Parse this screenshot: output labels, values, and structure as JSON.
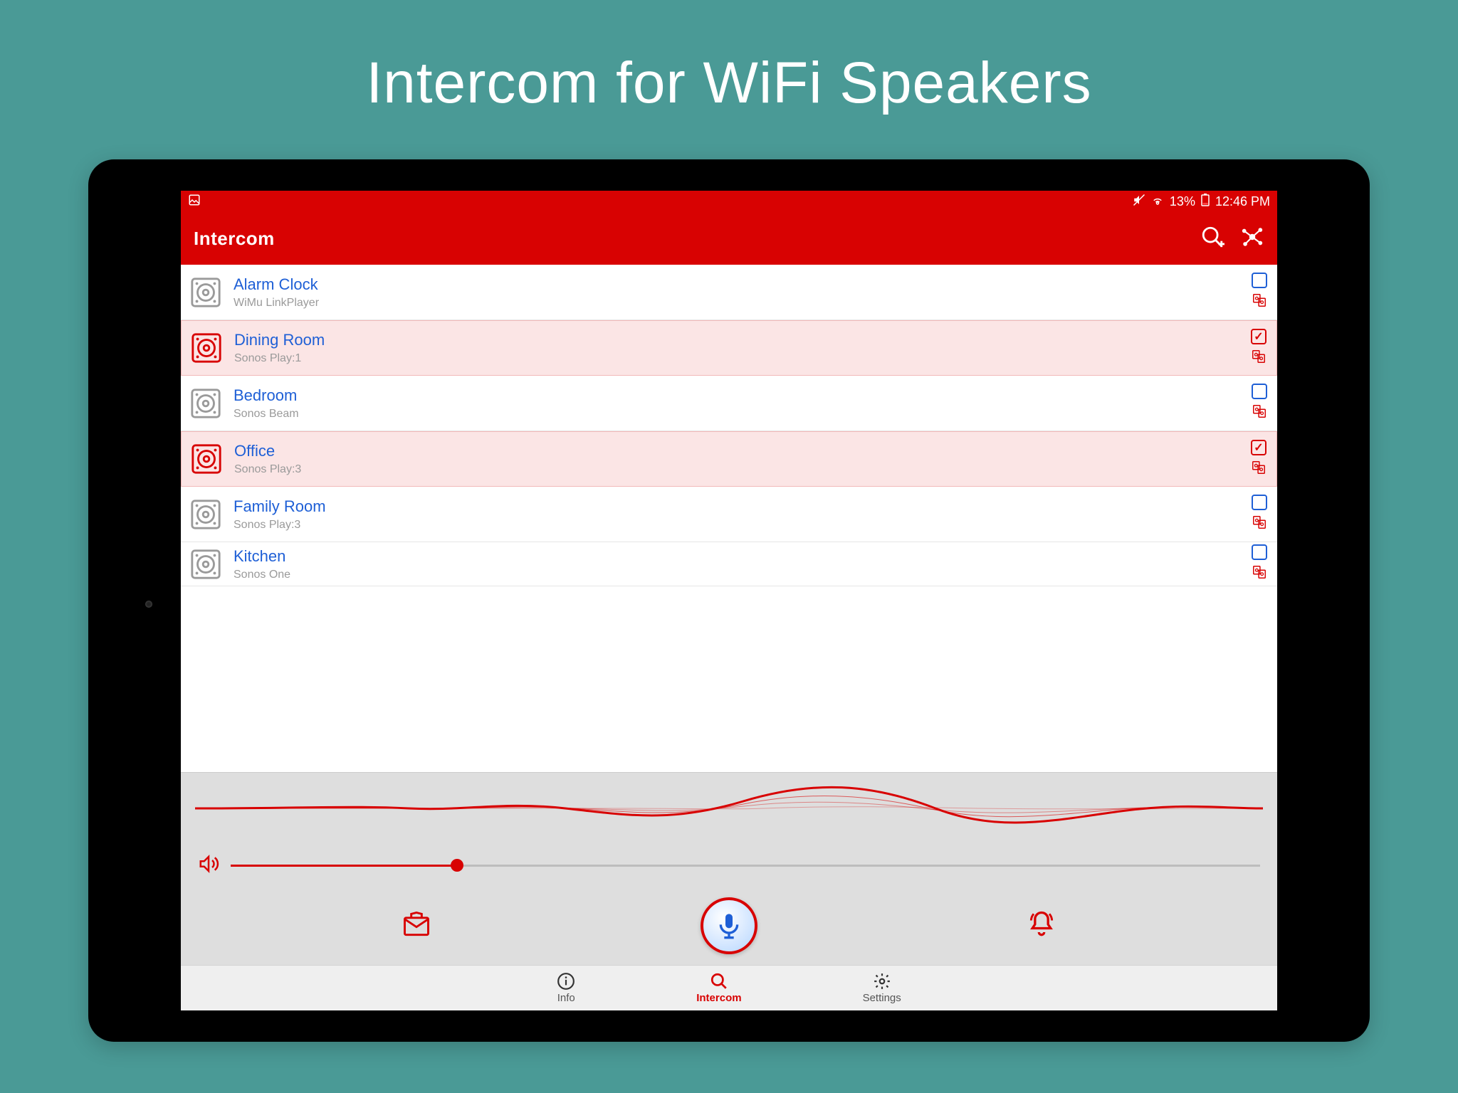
{
  "marketing_title": "Intercom for WiFi Speakers",
  "status_bar": {
    "battery_text": "13%",
    "time": "12:46 PM"
  },
  "header": {
    "title": "Intercom"
  },
  "speakers": [
    {
      "name": "Alarm Clock",
      "model": "WiMu LinkPlayer",
      "selected": false
    },
    {
      "name": "Dining Room",
      "model": "Sonos Play:1",
      "selected": true
    },
    {
      "name": "Bedroom",
      "model": "Sonos Beam",
      "selected": false
    },
    {
      "name": "Office",
      "model": "Sonos Play:3",
      "selected": true
    },
    {
      "name": "Family Room",
      "model": "Sonos Play:3",
      "selected": false
    },
    {
      "name": "Kitchen",
      "model": "Sonos One",
      "selected": false
    }
  ],
  "volume_percent": 22,
  "nav": {
    "info": "Info",
    "intercom": "Intercom",
    "settings": "Settings"
  },
  "colors": {
    "accent": "#d80202",
    "link": "#1e5fd6"
  }
}
